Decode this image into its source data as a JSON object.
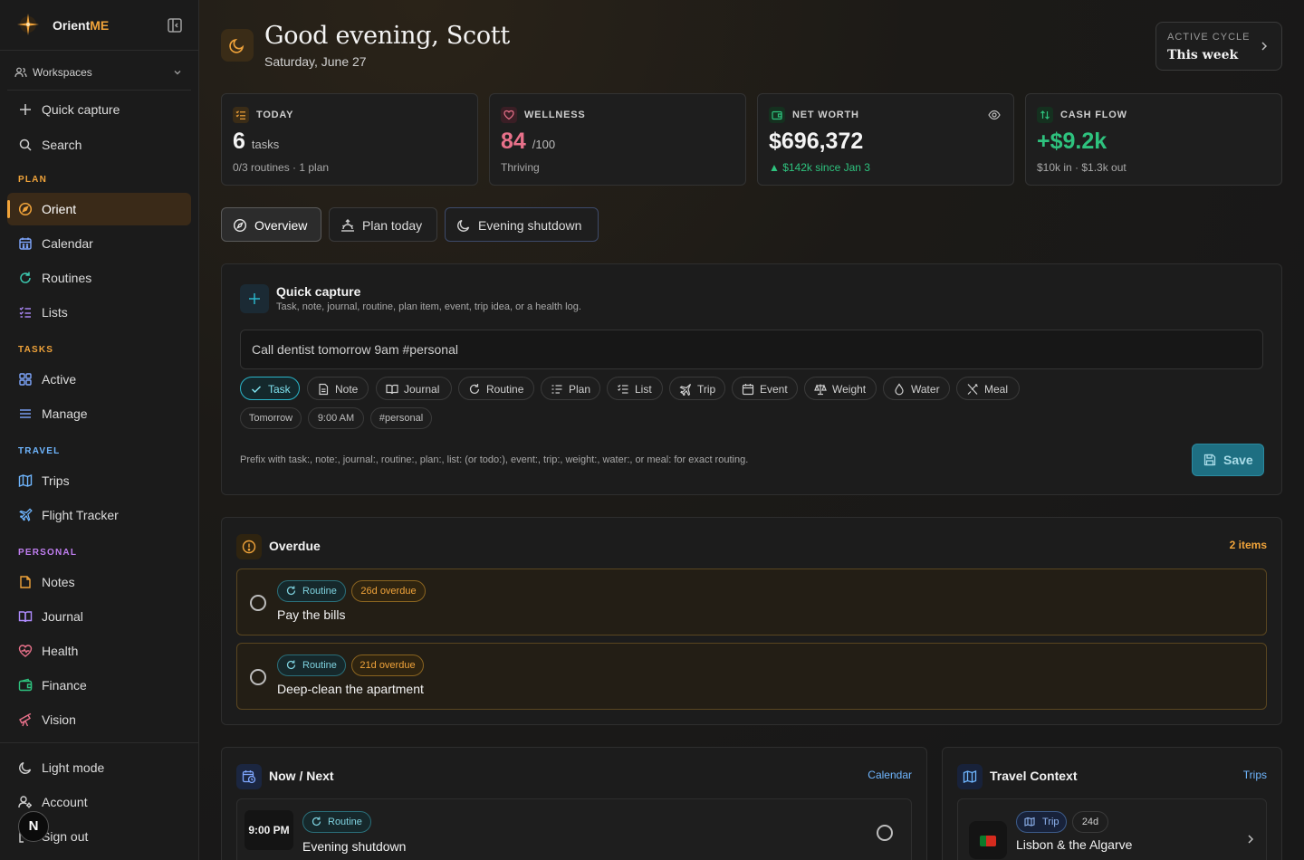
{
  "sidebar": {
    "brand": {
      "prefix": "Orient",
      "suffix": "ME"
    },
    "workspaces_label": "Workspaces",
    "top_items": [
      {
        "label": "Quick capture",
        "icon": "plus-icon"
      },
      {
        "label": "Search",
        "icon": "search-icon"
      }
    ],
    "sections": {
      "plan": "PLAN",
      "tasks": "TASKS",
      "travel": "TRAVEL",
      "personal": "PERSONAL"
    },
    "plan_items": [
      {
        "label": "Orient",
        "icon": "compass-icon",
        "active": true
      },
      {
        "label": "Calendar",
        "icon": "calendar-icon"
      },
      {
        "label": "Routines",
        "icon": "refresh-icon"
      },
      {
        "label": "Lists",
        "icon": "checklist-icon"
      }
    ],
    "task_items": [
      {
        "label": "Active",
        "icon": "grid-icon"
      },
      {
        "label": "Manage",
        "icon": "menu-icon"
      }
    ],
    "travel_items": [
      {
        "label": "Trips",
        "icon": "map-icon"
      },
      {
        "label": "Flight Tracker",
        "icon": "plane-icon"
      }
    ],
    "personal_items": [
      {
        "label": "Notes",
        "icon": "note-icon"
      },
      {
        "label": "Journal",
        "icon": "book-icon"
      },
      {
        "label": "Health",
        "icon": "heart-icon"
      },
      {
        "label": "Finance",
        "icon": "wallet-icon"
      },
      {
        "label": "Vision",
        "icon": "telescope-icon"
      }
    ],
    "bottom_items": [
      {
        "label": "Light mode",
        "icon": "moon-icon"
      },
      {
        "label": "Account",
        "icon": "user-icon"
      },
      {
        "label": "Sign out",
        "icon": "logout-icon"
      }
    ],
    "badge": "N"
  },
  "header": {
    "greeting": "Good evening, Scott",
    "date": "Saturday, June 27",
    "cycle_label": "ACTIVE CYCLE",
    "cycle_value": "This week"
  },
  "stats": [
    {
      "key": "TODAY",
      "value": "6",
      "unit": "tasks",
      "sub": "0/3 routines · 1 plan"
    },
    {
      "key": "WELLNESS",
      "value": "84",
      "unit": "/100",
      "sub": "Thriving"
    },
    {
      "key": "NET WORTH",
      "value": "$696,372",
      "unit": "",
      "sub": "▲ $142k since Jan 3"
    },
    {
      "key": "CASH FLOW",
      "value": "+$9.2k",
      "unit": "",
      "sub": "$10k in · $1.3k out"
    }
  ],
  "tabs": [
    {
      "label": "Overview"
    },
    {
      "label": "Plan today"
    },
    {
      "label": "Evening shutdown"
    }
  ],
  "quick_capture": {
    "title": "Quick capture",
    "subtitle": "Task, note, journal, routine, plan item, event, trip idea, or a health log.",
    "input_value": "Call dentist tomorrow 9am #personal",
    "types": [
      "Task",
      "Note",
      "Journal",
      "Routine",
      "Plan",
      "List",
      "Trip",
      "Event",
      "Weight",
      "Water",
      "Meal"
    ],
    "tags": [
      "Tomorrow",
      "9:00 AM",
      "#personal"
    ],
    "hint": "Prefix with task:, note:, journal:, routine:, plan:, list: (or todo:), event:, trip:, weight:, water:, or meal: for exact routing.",
    "save_label": "Save"
  },
  "overdue": {
    "title": "Overdue",
    "count": "2 items",
    "items": [
      {
        "type": "Routine",
        "overdue": "26d overdue",
        "title": "Pay the bills"
      },
      {
        "type": "Routine",
        "overdue": "21d overdue",
        "title": "Deep-clean the apartment"
      }
    ]
  },
  "now_next": {
    "title": "Now / Next",
    "link": "Calendar",
    "items": [
      {
        "time": "9:00 PM",
        "type": "Routine",
        "title": "Evening shutdown"
      }
    ]
  },
  "travel": {
    "title": "Travel Context",
    "link": "Trips",
    "items": [
      {
        "type": "Trip",
        "days": "24d",
        "title": "Lisbon & the Algarve"
      }
    ]
  },
  "colors": {
    "accent": "#f0a33a",
    "teal": "#2ab5c9",
    "wellness": "#e8718a",
    "positive": "#2ec27e"
  }
}
